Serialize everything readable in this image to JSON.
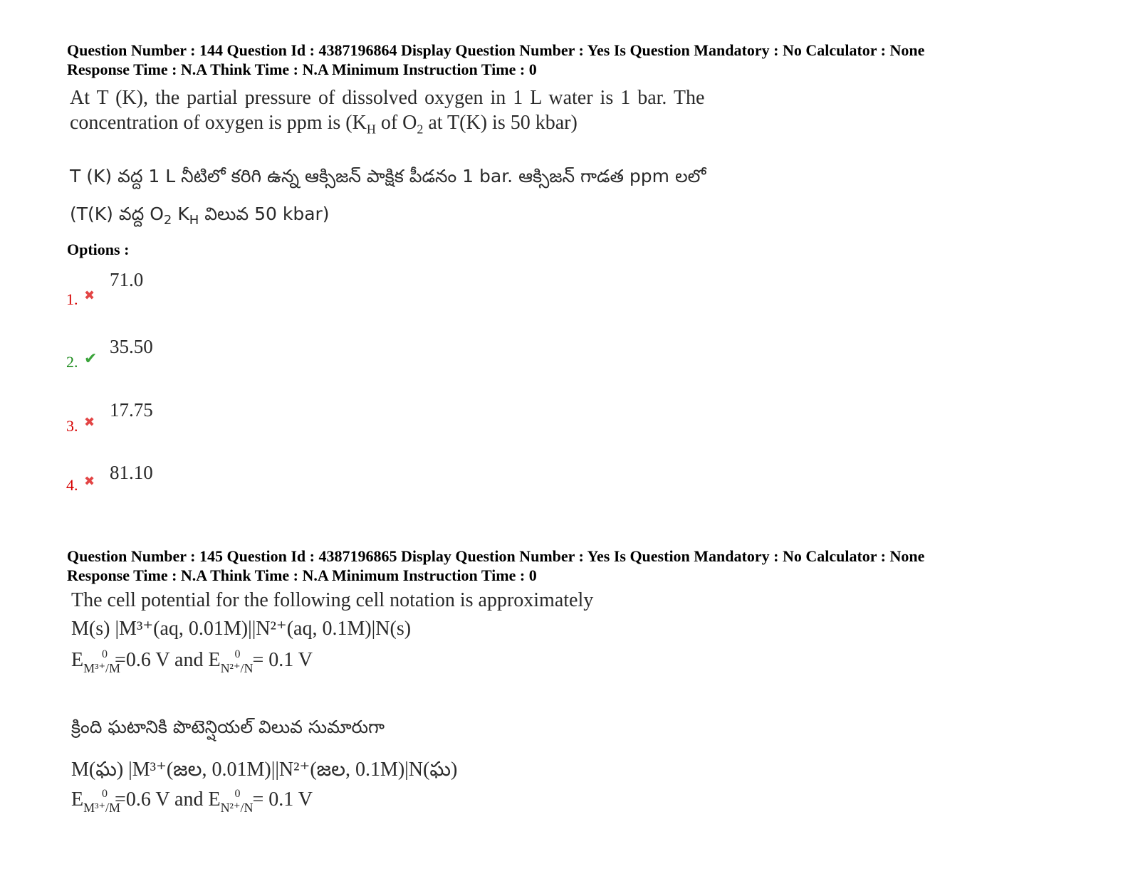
{
  "q144": {
    "meta_line1": "Question Number : 144 Question Id : 4387196864 Display Question Number : Yes Is Question Mandatory : No Calculator : None",
    "meta_line2": "Response Time : N.A Think Time : N.A Minimum Instruction Time : 0",
    "en_line1": "At T (K), the partial pressure of dissolved oxygen in 1 L water is 1 bar.   The",
    "en_line2_a": "concentration of oxygen is ppm is (K",
    "en_line2_sub1": "H",
    "en_line2_b": " of O",
    "en_line2_sub2": "2",
    "en_line2_c": " at T(K) is 50 kbar)",
    "te_line1": "T (K) వద్ద 1 L నీటిలో కరిగి ఉన్న ఆక్సిజన్ పాక్షిక పీడనం 1 bar.  ఆక్సిజన్ గాడత ppm లలో",
    "te_line2_a": "(T(K)  వద్ద O",
    "te_line2_sub1": "2",
    "te_line2_b": " K",
    "te_line2_sub2": "H",
    "te_line2_c": " విలువ 50 kbar)",
    "options_label": "Options :",
    "options": [
      {
        "num": "1.",
        "value": "71.0",
        "status": "wrong",
        "icon": "cross-icon",
        "glyph": "✖"
      },
      {
        "num": "2.",
        "value": "35.50",
        "status": "correct",
        "icon": "check-icon",
        "glyph": "✔"
      },
      {
        "num": "3.",
        "value": "17.75",
        "status": "wrong",
        "icon": "cross-icon",
        "glyph": "✖"
      },
      {
        "num": "4.",
        "value": "81.10",
        "status": "wrong",
        "icon": "cross-icon",
        "glyph": "✖"
      }
    ]
  },
  "q145": {
    "meta_line1": "Question Number : 145 Question Id : 4387196865 Display Question Number : Yes Is Question Mandatory : No Calculator : None",
    "meta_line2": "Response Time : N.A Think Time : N.A Minimum Instruction Time : 0",
    "en_line1": "The cell potential for the following cell notation is approximately",
    "en_cell": "M(s) |M³⁺(aq, 0.01M)||N²⁺(aq, 0.1M)|N(s)",
    "e_label": "E",
    "e_sup": "0",
    "e_sub1": "M³⁺/M",
    "e_mid": "=0.6 V and E",
    "e_sub2": "N²⁺/N",
    "e_end": " = 0.1 V",
    "te_line1": "క్రింది ఘటానికి పొటెన్షియల్ విలువ సుమారుగా",
    "te_cell": "M(ఘ) |M³⁺(జల, 0.01M)||N²⁺(జల, 0.1M)|N(ఘ)"
  },
  "colors": {
    "wrong": "#d60000",
    "correct": "#1a8a1a"
  }
}
